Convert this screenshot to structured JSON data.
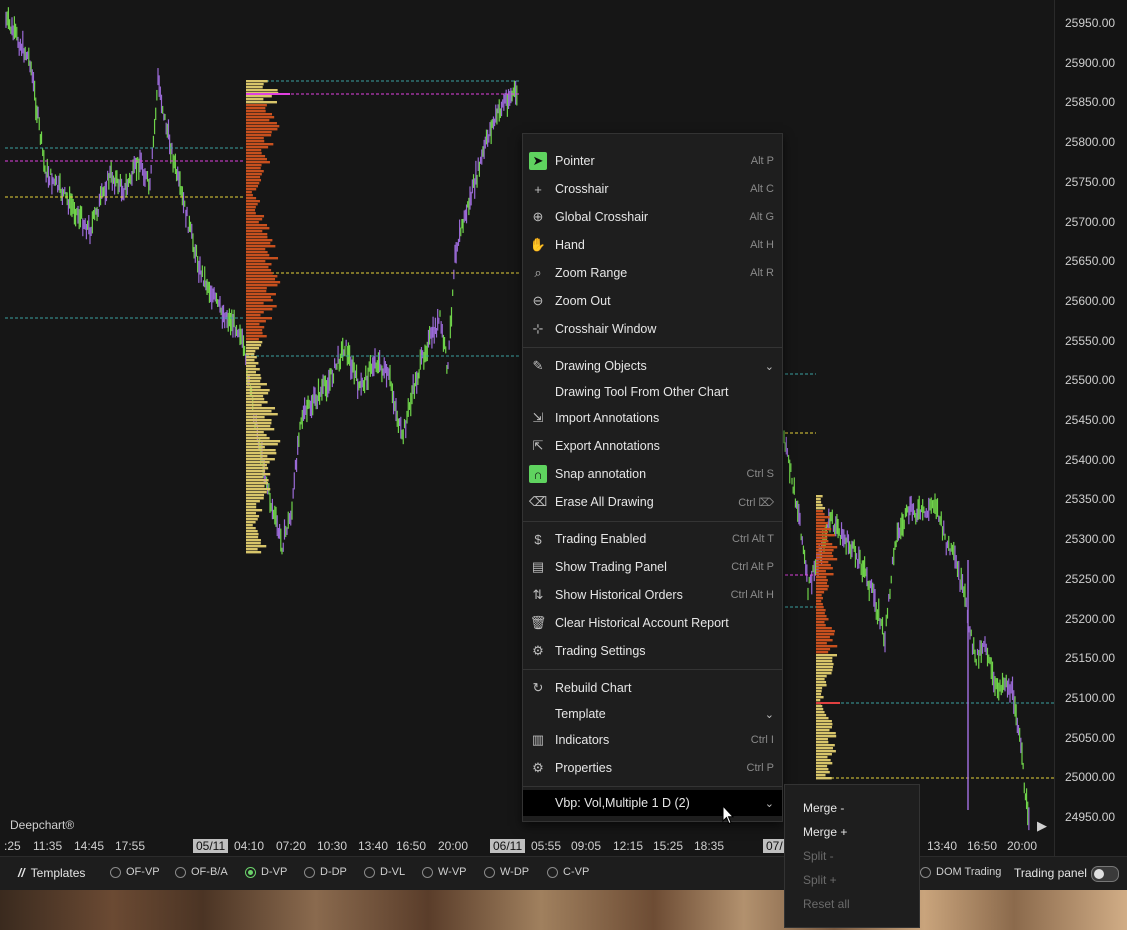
{
  "chart": {
    "brand": "Deepchart®",
    "price_labels": [
      "25950.00",
      "25900.00",
      "25850.00",
      "25800.00",
      "25750.00",
      "25700.00",
      "25650.00",
      "25600.00",
      "25550.00",
      "25500.00",
      "25450.00",
      "25400.00",
      "25350.00",
      "25300.00",
      "25250.00",
      "25200.00",
      "25150.00",
      "25100.00",
      "25050.00",
      "25000.00",
      "24950.00"
    ],
    "time_labels": [
      ":25",
      "11:35",
      "14:45",
      "17:55",
      "05/11",
      "04:10",
      "07:20",
      "10:30",
      "13:40",
      "16:50",
      "20:00",
      "06/11",
      "05:55",
      "09:05",
      "12:15",
      "15:25",
      "18:35",
      "07/",
      "13:40",
      "16:50",
      "20:00"
    ],
    "colors": {
      "up": "#6fd34a",
      "down": "#9a6ad6",
      "profile_red": "#c8501e",
      "profile_yellow": "#d8c56a",
      "poc": "#e040e0",
      "va": "#e6d23a",
      "level": "#3aa0a0"
    }
  },
  "context_menu": {
    "items": [
      {
        "label": "Pointer",
        "shortcut": "Alt P",
        "icon": "pointer-icon"
      },
      {
        "label": "Crosshair",
        "shortcut": "Alt C",
        "icon": "crosshair-icon"
      },
      {
        "label": "Global Crosshair",
        "shortcut": "Alt G",
        "icon": "global-crosshair-icon"
      },
      {
        "label": "Hand",
        "shortcut": "Alt H",
        "icon": "hand-icon"
      },
      {
        "label": "Zoom Range",
        "shortcut": "Alt R",
        "icon": "zoom-range-icon"
      },
      {
        "label": "Zoom Out",
        "shortcut": "",
        "icon": "zoom-out-icon"
      },
      {
        "label": "Crosshair Window",
        "shortcut": "",
        "icon": "crosshair-window-icon"
      },
      {
        "label": "Drawing Objects",
        "shortcut": "",
        "icon": "pencil-icon"
      },
      {
        "label": "Drawing Tool From Other Chart",
        "shortcut": "",
        "icon": ""
      },
      {
        "label": "Import Annotations",
        "shortcut": "",
        "icon": "import-icon"
      },
      {
        "label": "Export Annotations",
        "shortcut": "",
        "icon": "export-icon"
      },
      {
        "label": "Snap annotation",
        "shortcut": "Ctrl S",
        "icon": "magnet-icon"
      },
      {
        "label": "Erase All Drawing",
        "shortcut": "Ctrl ⌦",
        "icon": "eraser-icon"
      },
      {
        "label": "Trading Enabled",
        "shortcut": "Ctrl Alt T",
        "icon": "dollar-icon"
      },
      {
        "label": "Show Trading Panel",
        "shortcut": "Ctrl Alt P",
        "icon": "document-icon"
      },
      {
        "label": "Show Historical Orders",
        "shortcut": "Ctrl Alt H",
        "icon": "arrows-updown-icon"
      },
      {
        "label": "Clear Historical Account Report",
        "shortcut": "",
        "icon": "trash-icon"
      },
      {
        "label": "Trading Settings",
        "shortcut": "",
        "icon": "gear-icon"
      },
      {
        "label": "Rebuild Chart",
        "shortcut": "",
        "icon": "refresh-icon"
      },
      {
        "label": "Template",
        "shortcut": "",
        "icon": ""
      },
      {
        "label": "Indicators",
        "shortcut": "Ctrl I",
        "icon": "bars-icon"
      },
      {
        "label": "Properties",
        "shortcut": "Ctrl P",
        "icon": "gear-icon"
      },
      {
        "label": "Vbp: Vol,Multiple 1 D (2)",
        "shortcut": "",
        "icon": ""
      }
    ]
  },
  "sub_menu": {
    "items": [
      {
        "label": "Merge -",
        "disabled": false
      },
      {
        "label": "Merge +",
        "disabled": false
      },
      {
        "label": "Split -",
        "disabled": true
      },
      {
        "label": "Split +",
        "disabled": true
      },
      {
        "label": "Reset all",
        "disabled": true
      }
    ]
  },
  "bottom_bar": {
    "templates_label": "Templates",
    "options": [
      "OF-VP",
      "OF-B/A",
      "D-VP",
      "D-DP",
      "D-VL",
      "W-VP",
      "W-DP",
      "C-VP"
    ],
    "selected": "D-VP",
    "dom_trading": "DOM Trading",
    "trading_panel": "Trading panel"
  }
}
